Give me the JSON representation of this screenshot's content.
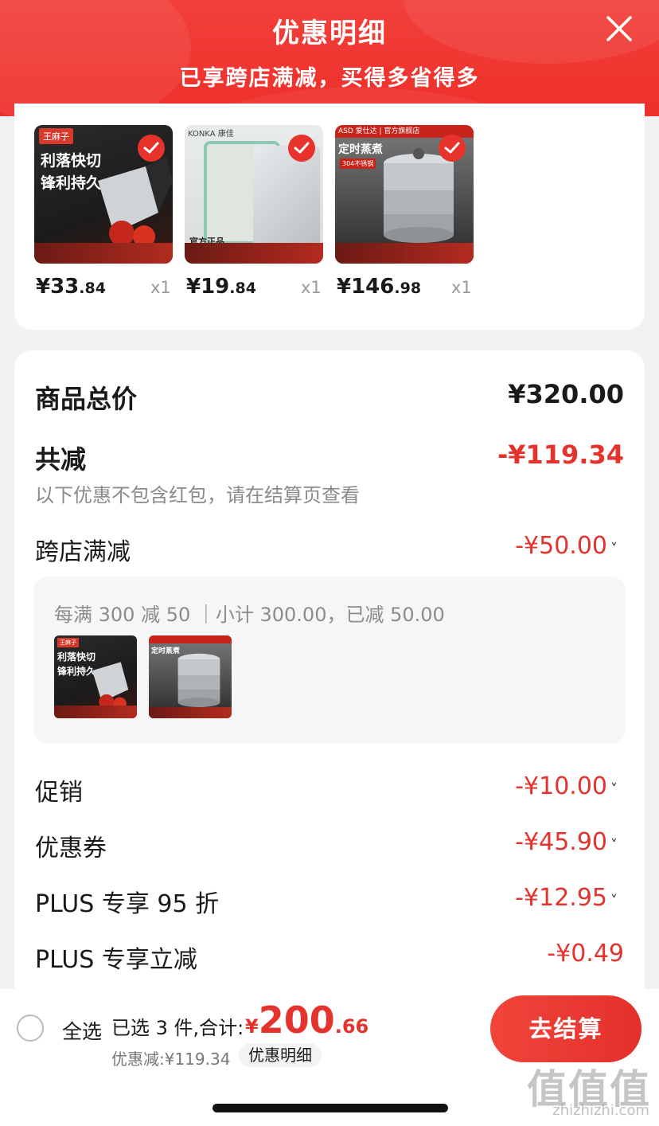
{
  "header": {
    "title": "优惠明细",
    "subtitle": "已享跨店满减，买得多省得多"
  },
  "products": [
    {
      "price_int": "¥33",
      "price_dec": ".84",
      "qty": "x1",
      "img_text_1": "利落快切",
      "img_text_2": "锋利持久",
      "brand": "王麻子"
    },
    {
      "price_int": "¥19",
      "price_dec": ".84",
      "qty": "x1",
      "brand": "KONKA 康佳",
      "img_text_1": "官方正品"
    },
    {
      "price_int": "¥146",
      "price_dec": ".98",
      "qty": "x1",
      "brand": "ASD 爱仕达 | 官方旗舰店",
      "img_text_1": "定时蒸煮",
      "img_text_2": "304不锈钢"
    }
  ],
  "summary": {
    "total_label": "商品总价",
    "total_value": "¥320.00",
    "reduce_label": "共减",
    "reduce_value": "-¥119.34",
    "reduce_note": "以下优惠不包含红包，请在结算页查看",
    "cross_store_label": "跨店满减",
    "cross_store_value": "-¥50.00",
    "cross_store_rule": "每满 300 减 50 ｜小计 300.00，已减 50.00",
    "promo_label": "促销",
    "promo_value": "-¥10.00",
    "coupon_label": "优惠券",
    "coupon_value": "-¥45.90",
    "plus95_label": "PLUS 专享 95 折",
    "plus95_value": "-¥12.95",
    "plus_instant_label": "PLUS 专享立减",
    "plus_instant_value": "-¥0.49",
    "chevron": "˅"
  },
  "bottom": {
    "select_all": "全选",
    "selected_info": "已选 3 件,合计:",
    "total_cur": "¥",
    "total_int": "200",
    "total_dec": ".66",
    "reduce_info": "优惠减:¥119.34",
    "detail_chip": "优惠明细",
    "checkout": "去结算"
  },
  "watermark": {
    "main": "值值值",
    "sub": "zhizhizhi.com"
  },
  "colors": {
    "accent": "#e3332c",
    "header_bg": "#ee2f2a"
  }
}
